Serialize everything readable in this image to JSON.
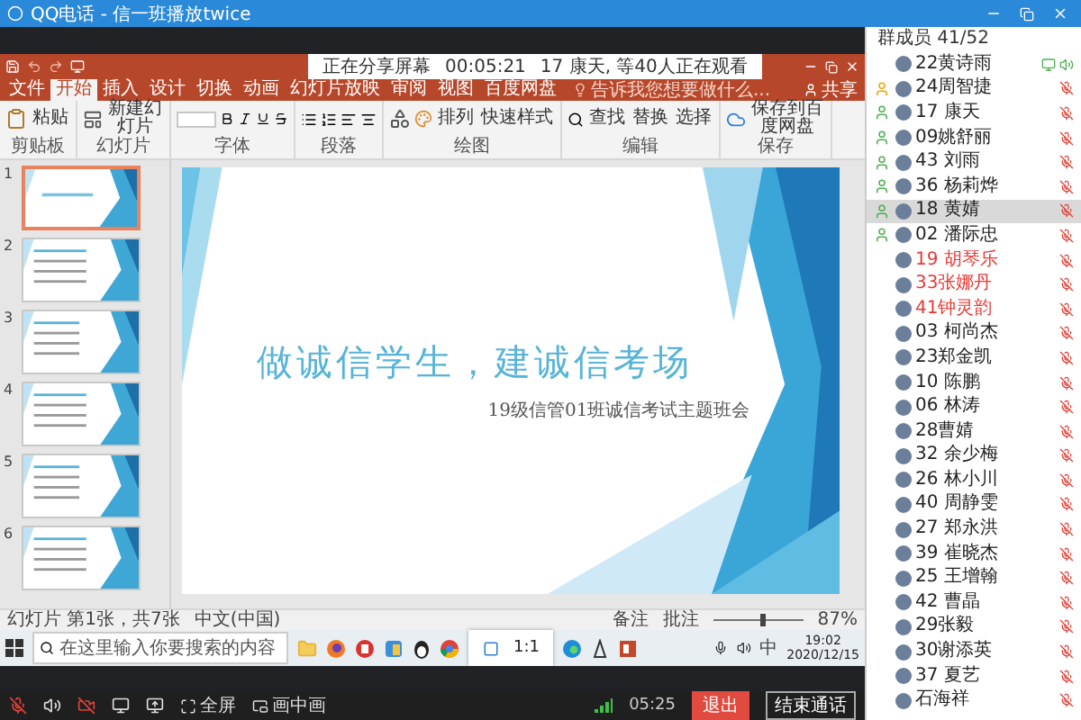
{
  "window": {
    "title": "QQ电话 - 信一班播放twice"
  },
  "share_notice": {
    "status": "正在分享屏幕",
    "time": "00:05:21",
    "viewers": "17 康天, 等40人正在观看"
  },
  "ppt": {
    "tabs": [
      {
        "label": "文件",
        "selected": false
      },
      {
        "label": "开始",
        "selected": true
      },
      {
        "label": "插入",
        "selected": false
      },
      {
        "label": "设计",
        "selected": false
      },
      {
        "label": "切换",
        "selected": false
      },
      {
        "label": "动画",
        "selected": false
      },
      {
        "label": "幻灯片放映",
        "selected": false
      },
      {
        "label": "审阅",
        "selected": false
      },
      {
        "label": "视图",
        "selected": false
      },
      {
        "label": "百度网盘",
        "selected": false
      }
    ],
    "search": {
      "placeholder": "告诉我您想要做什么..."
    },
    "share": "共享",
    "ribbon_groups": [
      {
        "label": "剪贴板",
        "kind": "clipboard",
        "buttons": [
          "粘贴"
        ]
      },
      {
        "label": "幻灯片",
        "kind": "slides",
        "buttons": [
          "新建幻灯片"
        ]
      },
      {
        "label": "字体",
        "kind": "font"
      },
      {
        "label": "段落",
        "kind": "paragraph"
      },
      {
        "label": "绘图",
        "kind": "drawing",
        "buttons": [
          "排列",
          "快速样式"
        ]
      },
      {
        "label": "编辑",
        "kind": "editing",
        "buttons": [
          "查找",
          "替换",
          "选择"
        ]
      },
      {
        "label": "保存",
        "kind": "save",
        "buttons": [
          "保存到百度网盘"
        ]
      }
    ],
    "thumbnails": [
      {
        "number": "1",
        "selected": true
      },
      {
        "number": "2",
        "selected": false
      },
      {
        "number": "3",
        "selected": false
      },
      {
        "number": "4",
        "selected": false
      },
      {
        "number": "5",
        "selected": false
      },
      {
        "number": "6",
        "selected": false
      }
    ],
    "slide": {
      "title": "做诚信学生，建诚信考场",
      "subtitle": "19级信管01班诚信考试主题班会"
    },
    "status_bar": {
      "position": "幻灯片 第1张，共7张",
      "language": "中文(中国)",
      "notes": "备注",
      "comments": "批注",
      "zoom": "87%",
      "zoom_slider": {
        "level": 0.55
      }
    }
  },
  "taskbar": {
    "search": {
      "placeholder": "在这里输入你要搜索的内容"
    },
    "popup": "1:1",
    "ime": "中",
    "time": "19:02",
    "date": "2020/12/15"
  },
  "call_bar": {
    "mic_muted": true,
    "camera_off": true,
    "fullscreen": "全屏",
    "pip": "画中画",
    "duration": "05:25",
    "exit": "退出",
    "end": "结束通话"
  },
  "members": {
    "title": "群成员 41/52",
    "items": [
      {
        "name": "22黄诗雨",
        "kind": "member",
        "sharing": true,
        "muted": false,
        "selected": false,
        "color": "#222222"
      },
      {
        "name": "24周智捷",
        "kind": "owner",
        "sharing": false,
        "muted": true,
        "selected": false,
        "color": "#222222"
      },
      {
        "name": "17 康天",
        "kind": "admin",
        "sharing": false,
        "muted": true,
        "selected": false,
        "color": "#222222"
      },
      {
        "name": "09姚舒丽",
        "kind": "admin",
        "sharing": false,
        "muted": true,
        "selected": false,
        "color": "#222222"
      },
      {
        "name": "43 刘雨",
        "kind": "admin",
        "sharing": false,
        "muted": true,
        "selected": false,
        "color": "#222222"
      },
      {
        "name": "36 杨莉烨",
        "kind": "admin",
        "sharing": false,
        "muted": true,
        "selected": false,
        "color": "#222222"
      },
      {
        "name": "18 黄婧",
        "kind": "admin",
        "sharing": false,
        "muted": true,
        "selected": true,
        "color": "#222222"
      },
      {
        "name": "02 潘际忠",
        "kind": "admin",
        "sharing": false,
        "muted": true,
        "selected": false,
        "color": "#222222"
      },
      {
        "name": "19 胡琴乐",
        "kind": "member",
        "sharing": false,
        "muted": true,
        "selected": false,
        "color": "#e53935"
      },
      {
        "name": "33张娜丹",
        "kind": "member",
        "sharing": false,
        "muted": true,
        "selected": false,
        "color": "#e53935"
      },
      {
        "name": "41钟灵韵",
        "kind": "member",
        "sharing": false,
        "muted": true,
        "selected": false,
        "color": "#e53935"
      },
      {
        "name": "03 柯尚杰",
        "kind": "member",
        "sharing": false,
        "muted": true,
        "selected": false,
        "color": "#222222"
      },
      {
        "name": "23郑金凯",
        "kind": "member",
        "sharing": false,
        "muted": true,
        "selected": false,
        "color": "#222222"
      },
      {
        "name": "10 陈鹏",
        "kind": "member",
        "sharing": false,
        "muted": true,
        "selected": false,
        "color": "#222222"
      },
      {
        "name": "06 林涛",
        "kind": "member",
        "sharing": false,
        "muted": true,
        "selected": false,
        "color": "#222222"
      },
      {
        "name": "28曹婧",
        "kind": "member",
        "sharing": false,
        "muted": true,
        "selected": false,
        "color": "#222222"
      },
      {
        "name": "32 余少梅",
        "kind": "member",
        "sharing": false,
        "muted": true,
        "selected": false,
        "color": "#222222"
      },
      {
        "name": "26 林小川",
        "kind": "member",
        "sharing": false,
        "muted": true,
        "selected": false,
        "color": "#222222"
      },
      {
        "name": "40 周静雯",
        "kind": "member",
        "sharing": false,
        "muted": true,
        "selected": false,
        "color": "#222222"
      },
      {
        "name": "27 郑永洪",
        "kind": "member",
        "sharing": false,
        "muted": true,
        "selected": false,
        "color": "#222222"
      },
      {
        "name": "39 崔晓杰",
        "kind": "member",
        "sharing": false,
        "muted": true,
        "selected": false,
        "color": "#222222"
      },
      {
        "name": "25 王增翰",
        "kind": "member",
        "sharing": false,
        "muted": true,
        "selected": false,
        "color": "#222222"
      },
      {
        "name": "42 曹晶",
        "kind": "member",
        "sharing": false,
        "muted": true,
        "selected": false,
        "color": "#222222"
      },
      {
        "name": "29张毅",
        "kind": "member",
        "sharing": false,
        "muted": true,
        "selected": false,
        "color": "#222222"
      },
      {
        "name": "30谢添英",
        "kind": "member",
        "sharing": false,
        "muted": true,
        "selected": false,
        "color": "#222222"
      },
      {
        "name": "37 夏艺",
        "kind": "member",
        "sharing": false,
        "muted": true,
        "selected": false,
        "color": "#222222"
      },
      {
        "name": "石海祥",
        "kind": "member",
        "sharing": false,
        "muted": true,
        "selected": false,
        "color": "#222222"
      }
    ]
  }
}
